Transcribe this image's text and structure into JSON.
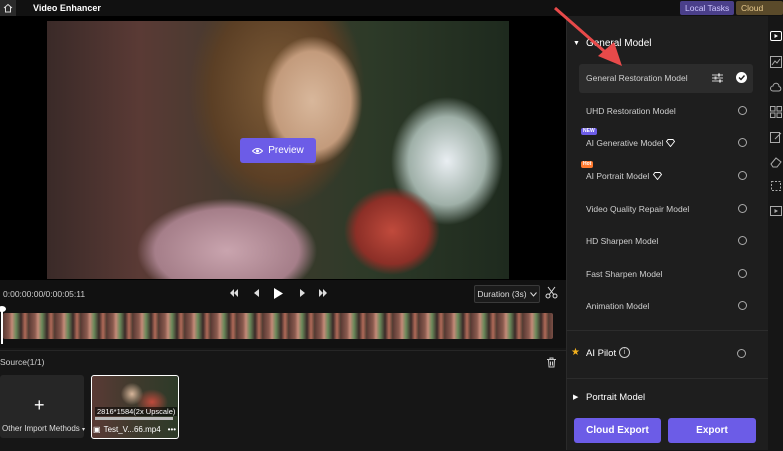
{
  "app": {
    "title": "Video Enhancer"
  },
  "header": {
    "local_tasks": "Local Tasks",
    "cloud_task": "Cloud Task"
  },
  "preview": {
    "button_label": "Preview"
  },
  "transport": {
    "timecode": "0:00:00:00/0:00:05:11",
    "duration": "Duration (3s)"
  },
  "source": {
    "label": "Source(1/1)",
    "import_label": "Other Import Methods",
    "clip_resolution": "2816*1584(2x Upscale)",
    "clip_name": "Test_V...66.mp4"
  },
  "panel": {
    "general_model": "General Model",
    "models": [
      {
        "label": "General Restoration Model",
        "selected": true
      },
      {
        "label": "UHD Restoration Model"
      },
      {
        "label": "AI Generative Model",
        "badge": "NEW"
      },
      {
        "label": "AI Portrait Model",
        "badge": "Hot"
      },
      {
        "label": "Video Quality Repair Model"
      },
      {
        "label": "HD Sharpen Model"
      },
      {
        "label": "Fast Sharpen Model"
      },
      {
        "label": "Animation Model"
      }
    ],
    "ai_pilot": "AI Pilot",
    "portrait_model": "Portrait Model",
    "cloud_export": "Cloud Export",
    "export": "Export"
  },
  "colors": {
    "accent": "#6c5ce7",
    "annotation": "#e84a4a"
  }
}
